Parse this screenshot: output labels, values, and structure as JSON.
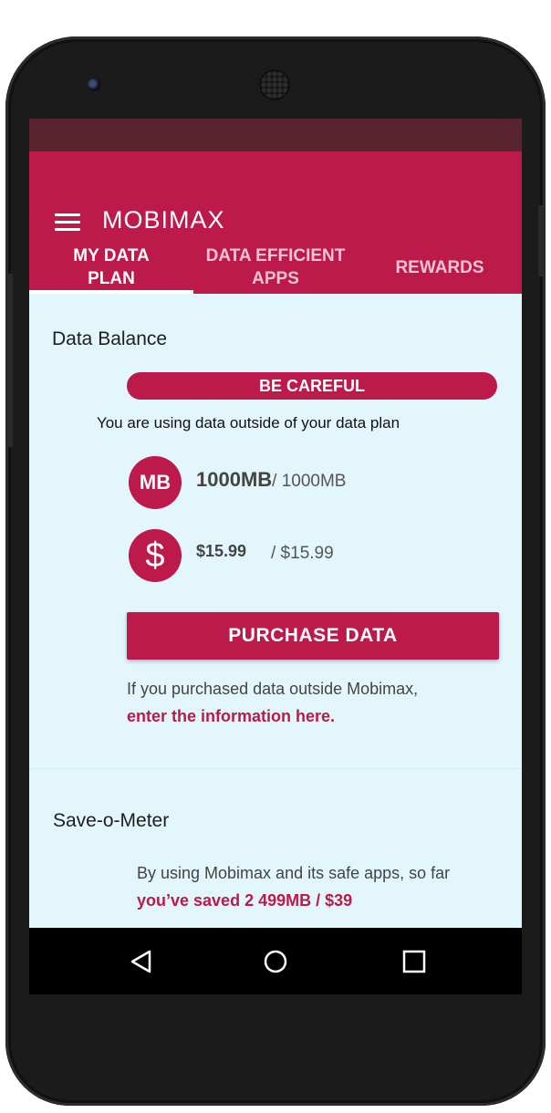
{
  "app": {
    "title": "MOBIMAX",
    "menu_icon": "hamburger-menu-icon"
  },
  "tabs": [
    {
      "label": "MY DATA PLAN",
      "active": true
    },
    {
      "label": "DATA EFFICIENT APPS",
      "active": false
    },
    {
      "label": "REWARDS",
      "active": false
    }
  ],
  "data_balance": {
    "title": "Data Balance",
    "warning_badge": "BE CAREFUL",
    "warning_text": "You are using data outside of your data plan",
    "mb_icon_label": "MB",
    "dollar_icon_label": "$",
    "data_used": "1000MB",
    "data_limit": "/ 1000MB",
    "cost_used": "$15.99",
    "cost_limit": "/ $15.99",
    "purchase_button": "PURCHASE DATA",
    "info_text": "If you purchased data outside Mobimax,",
    "info_link": "enter the information here."
  },
  "save_o_meter": {
    "title": "Save-o-Meter",
    "text": "By using Mobimax and its safe apps, so far",
    "savings": "you’ve saved 2 499MB / $39"
  },
  "colors": {
    "accent": "#bb1a4a",
    "status_bar": "#5a2330",
    "background": "#e2f6fb"
  },
  "nav_icons": [
    "back-icon",
    "home-icon",
    "recent-apps-icon"
  ]
}
